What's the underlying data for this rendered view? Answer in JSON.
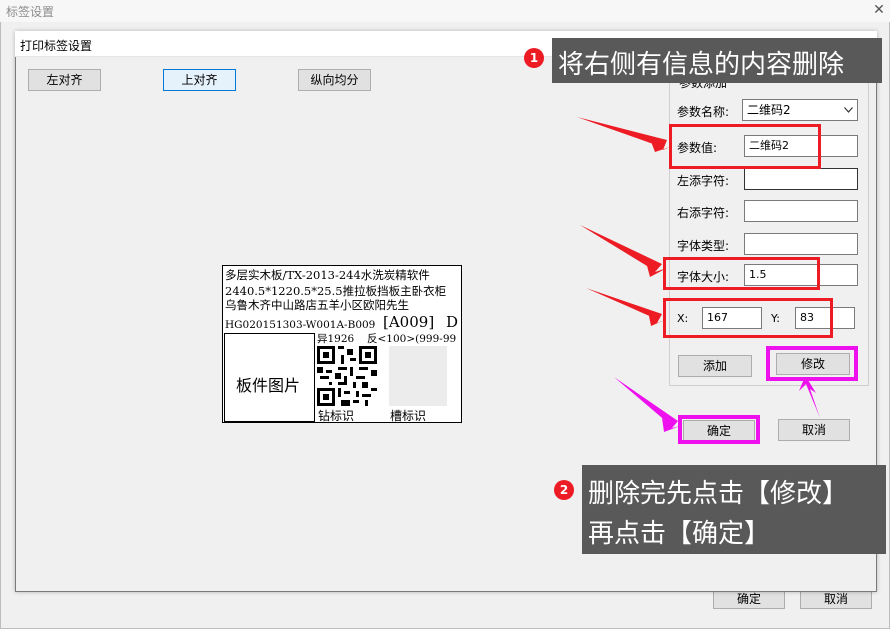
{
  "outer_window": {
    "title": "标签设置",
    "close_glyph": "✕",
    "ok_label": "确定",
    "cancel_label": "取消"
  },
  "dialog": {
    "title": "打印标签设置",
    "toolbar": {
      "align_left": "左对齐",
      "align_top": "上对齐",
      "distribute_vertical": "纵向均分"
    }
  },
  "label": {
    "line1": "多层实木板/TX-2013-244水洗炭精软件",
    "line2": "2440.5*1220.5*25.5推拉板挡板主卧衣柜",
    "line3": "乌鲁木齐中山路店五羊小区欧阳先生",
    "barcode_text": "HG020151303-W001A-B009",
    "code_box": "[A009]",
    "code_d": "D",
    "info_left": "异1926",
    "info_right": "反<100>(999-99",
    "image_caption": "板件图片",
    "drill_mark": "钻标识",
    "groove_mark": "槽标识"
  },
  "panel": {
    "group_title": "参数添加",
    "param_name_label": "参数名称:",
    "param_name_value": "二维码2",
    "param_value_label": "参数值:",
    "param_value": "二维码2",
    "left_add_label": "左添字符:",
    "left_add_value": "",
    "right_add_label": "右添字符:",
    "right_add_value": "",
    "font_type_label": "字体类型:",
    "font_type_value": "",
    "font_size_label": "字体大小:",
    "font_size_value": "1.5",
    "x_label": "X:",
    "x_value": "167",
    "y_label": "Y:",
    "y_value": "83",
    "add_button": "添加",
    "modify_button": "修改",
    "ok_button": "确定",
    "cancel_button": "取消"
  },
  "annotations": {
    "step1_number": "1",
    "step1_text": "将右侧有信息的内容删除",
    "step2_number": "2",
    "step2_line1": "删除完先点击【修改】",
    "step2_line2": "再点击【确定】"
  },
  "colors": {
    "highlight_red": "#ed1c24",
    "highlight_magenta": "#ee11ee",
    "callout_background": "#595959"
  }
}
